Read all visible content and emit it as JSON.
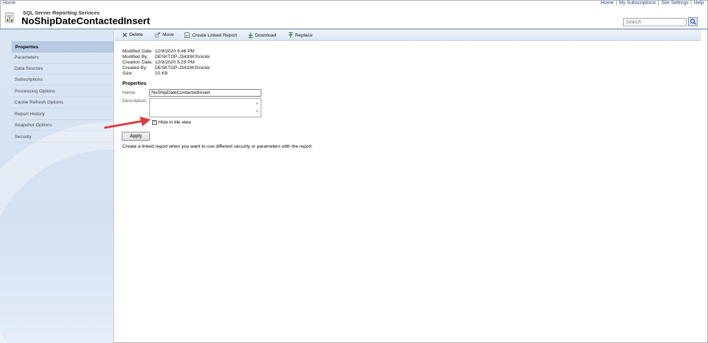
{
  "topbar": {
    "home_link": "Home",
    "links": [
      "Home",
      "My Subscriptions",
      "Site Settings",
      "Help"
    ]
  },
  "header": {
    "subtitle": "SQL Server Reporting Services",
    "title": "NoShipDateContactedInsert",
    "search_placeholder": "Search"
  },
  "toolbar": {
    "delete": "Delete",
    "move": "Move",
    "create_linked": "Create Linked Report",
    "download": "Download",
    "replace": "Replace"
  },
  "sidebar": {
    "items": [
      {
        "label": "Properties",
        "active": true
      },
      {
        "label": "Parameters"
      },
      {
        "label": "Data Sources"
      },
      {
        "label": "Subscriptions"
      },
      {
        "label": "Processing Options"
      },
      {
        "label": "Cache Refresh Options"
      },
      {
        "label": "Report History"
      },
      {
        "label": "Snapshot Options"
      },
      {
        "label": "Security"
      }
    ]
  },
  "meta": {
    "modified_date_label": "Modified Date:",
    "modified_date": "12/9/2020 8:46 PM",
    "modified_by_label": "Modified By:",
    "modified_by": "DESKTOP-J3433KS\\nickk",
    "creation_date_label": "Creation Date:",
    "creation_date": "12/9/2020 5:29 PM",
    "created_by_label": "Created By:",
    "created_by": "DESKTOP-J3433KS\\nickk",
    "size_label": "Size:",
    "size": "10 KB"
  },
  "properties": {
    "section_title": "Properties",
    "name_label": "Name:",
    "name_value": "NoShipDateContactedInsert",
    "description_label": "Description:",
    "hide_label": "Hide in tile view",
    "hide_checked": true,
    "apply_label": "Apply",
    "help_text": "Create a linked report when you want to use different security or parameters with the report."
  },
  "colors": {
    "link": "#2b4f8c",
    "sidebar_bg": "#d4e1f2",
    "arrow": "#e0393a"
  }
}
